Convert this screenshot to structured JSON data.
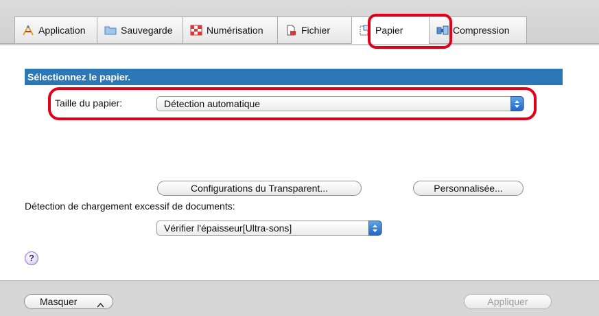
{
  "tabs": [
    {
      "label": "Application",
      "icon": "application-icon"
    },
    {
      "label": "Sauvegarde",
      "icon": "folder-icon"
    },
    {
      "label": "Numérisation",
      "icon": "scan-icon"
    },
    {
      "label": "Fichier",
      "icon": "file-icon"
    },
    {
      "label": "Papier",
      "icon": "paper-icon"
    },
    {
      "label": "Compression",
      "icon": "compression-icon"
    }
  ],
  "section": {
    "title": "Sélectionnez le papier."
  },
  "paper_size": {
    "label": "Taille du papier:",
    "value": "Détection automatique"
  },
  "buttons": {
    "transparent": "Configurations du Transparent...",
    "custom": "Personnalisée...",
    "hide": "Masquer",
    "apply": "Appliquer"
  },
  "overload": {
    "label": "Détection de chargement excessif de documents:",
    "value": "Vérifier l'épaisseur[Ultra-sons]"
  },
  "help": {
    "symbol": "?"
  },
  "colors": {
    "section_header": "#2c78b6",
    "highlight": "#e3001b",
    "stepper": "#1f68c8"
  }
}
